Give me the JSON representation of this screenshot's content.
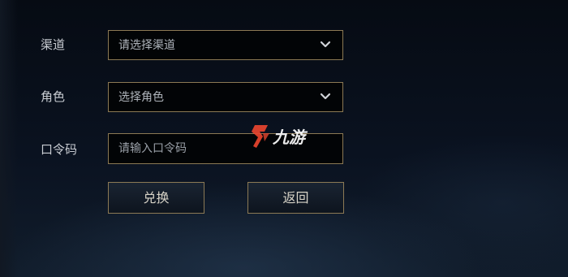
{
  "form": {
    "channel": {
      "label": "渠道",
      "value": "请选择渠道"
    },
    "role": {
      "label": "角色",
      "value": "选择角色"
    },
    "code": {
      "label": "口令码",
      "placeholder": "请输入口令码",
      "value": ""
    }
  },
  "buttons": {
    "redeem": "兑换",
    "back": "返回"
  },
  "watermark": {
    "text": "九游",
    "accent_color": "#e8452f",
    "text_color": "#ffffff"
  },
  "theme": {
    "border_gold": "#8c7a55",
    "background_dark": "#0a1220",
    "text_light": "#c8ccd2"
  }
}
